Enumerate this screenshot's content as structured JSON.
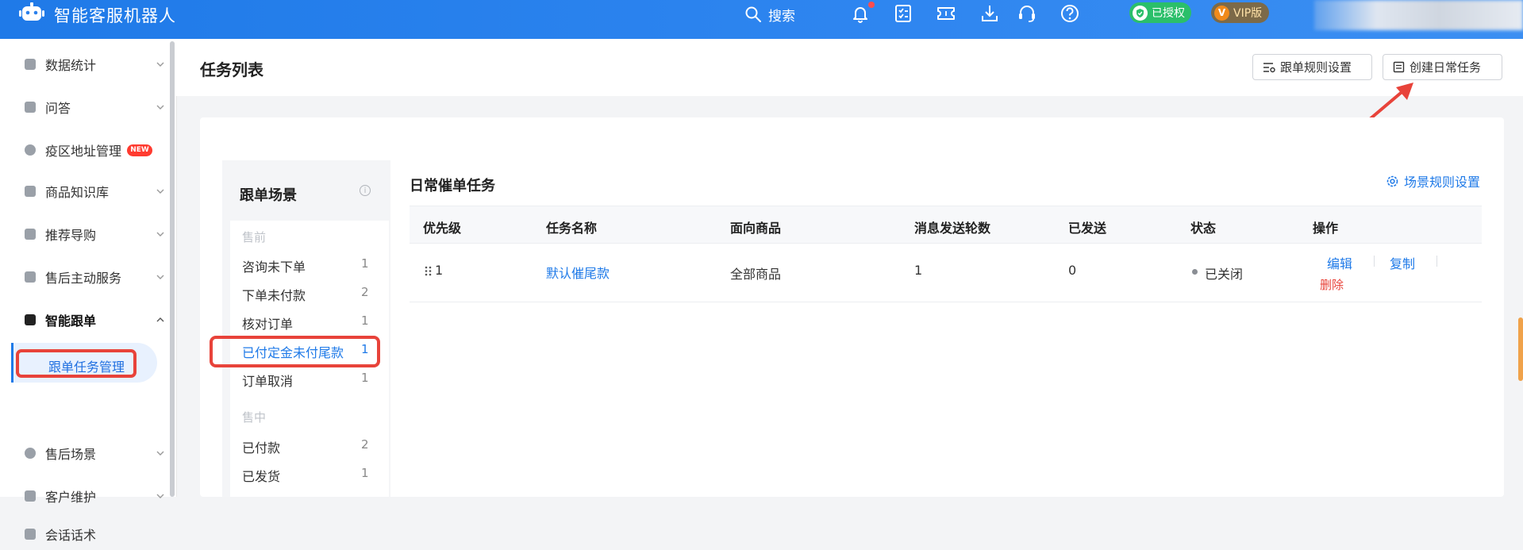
{
  "app": {
    "title": "智能客服机器人"
  },
  "topbar": {
    "search_label": "搜索",
    "auth_badge": "已授权",
    "vip_badge": "VIP版",
    "vip_icon_text": "V"
  },
  "sidebar": {
    "items": [
      {
        "label": "数据统计"
      },
      {
        "label": "问答"
      },
      {
        "label": "疫区地址管理",
        "badge": "NEW"
      },
      {
        "label": "商品知识库"
      },
      {
        "label": "推荐导购"
      },
      {
        "label": "售后主动服务"
      },
      {
        "label": "智能跟单"
      },
      {
        "label": "售后场景"
      },
      {
        "label": "客户维护"
      },
      {
        "label": "会话话术"
      }
    ],
    "sub_active": "跟单任务管理"
  },
  "page": {
    "title": "任务列表",
    "btn_rules": "跟单规则设置",
    "btn_create": "创建日常任务"
  },
  "scene": {
    "title": "跟单场景",
    "info_icon": "i",
    "groups": [
      {
        "name": "售前",
        "items": [
          {
            "label": "咨询未下单",
            "count": "1"
          },
          {
            "label": "下单未付款",
            "count": "2"
          },
          {
            "label": "核对订单",
            "count": "1"
          },
          {
            "label": "已付定金未付尾款",
            "count": "1"
          },
          {
            "label": "订单取消",
            "count": "1"
          }
        ]
      },
      {
        "name": "售中",
        "items": [
          {
            "label": "已付款",
            "count": "2"
          },
          {
            "label": "已发货",
            "count": "1"
          }
        ]
      }
    ]
  },
  "table": {
    "title": "日常催单任务",
    "rule_link": "场景规则设置",
    "headers": [
      "优先级",
      "任务名称",
      "面向商品",
      "消息发送轮数",
      "已发送",
      "状态",
      "操作"
    ],
    "rows": [
      {
        "priority": "1",
        "name": "默认催尾款",
        "product": "全部商品",
        "rounds": "1",
        "sent": "0",
        "status": "已关闭",
        "ops": {
          "edit": "编辑",
          "copy": "复制",
          "delete": "删除"
        }
      }
    ]
  },
  "colors": {
    "brand": "#1f7ae8",
    "highlight": "#e8433a",
    "authorized": "#2bbf6a"
  }
}
